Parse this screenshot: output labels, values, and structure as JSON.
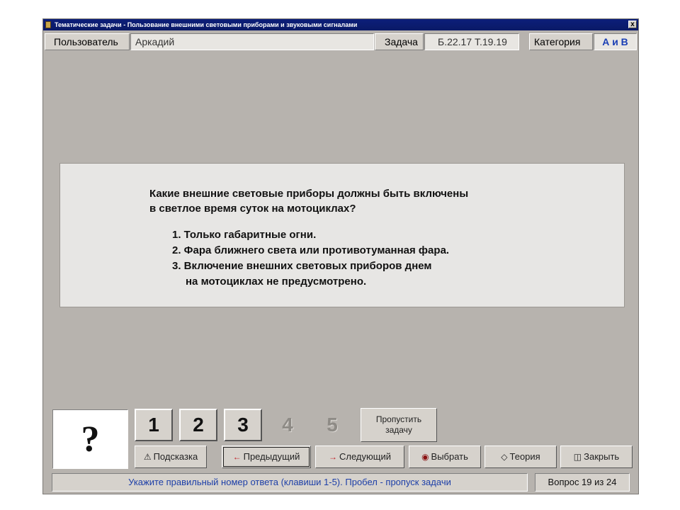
{
  "window": {
    "title": "Тематические задачи - Пользование внешними световыми приборами и звуковыми сигналами",
    "close_glyph": "x"
  },
  "infobar": {
    "user_label": "Пользователь",
    "user_value": "Аркадий",
    "task_label": "Задача",
    "task_value": "Б.22.17  Т.19.19",
    "category_label": "Категория",
    "category_value": "А и В"
  },
  "question": {
    "lines": [
      "Какие внешние световые приборы должны быть включены",
      "в светлое время суток на мотоциклах?"
    ],
    "answers": [
      "1. Только габаритные огни.",
      "2. Фара ближнего света или противотуманная фара.",
      "3. Включение внешних световых приборов днем",
      "на мотоциклах не предусмотрено."
    ]
  },
  "answer_indicator": "?",
  "answer_buttons": [
    "1",
    "2",
    "3",
    "4",
    "5"
  ],
  "skip_button": {
    "line1": "Пропустить",
    "line2": "задачу"
  },
  "actions": {
    "hint": "Подсказка",
    "prev": "Предыдущий",
    "next": "Следующий",
    "choose": "Выбрать",
    "theory": "Теория",
    "close": "Закрыть"
  },
  "status": {
    "hint_text": "Укажите правильный номер ответа (клавиши 1-5). Пробел - пропуск задачи",
    "question_counter": "Вопрос 19 из 24"
  },
  "colors": {
    "title_bar": "#0a1966",
    "category_value": "#1a3fb5",
    "status_text": "#1d3fa8",
    "window_bg": "#b7b3ae",
    "next_arrow": "#c0181f"
  }
}
